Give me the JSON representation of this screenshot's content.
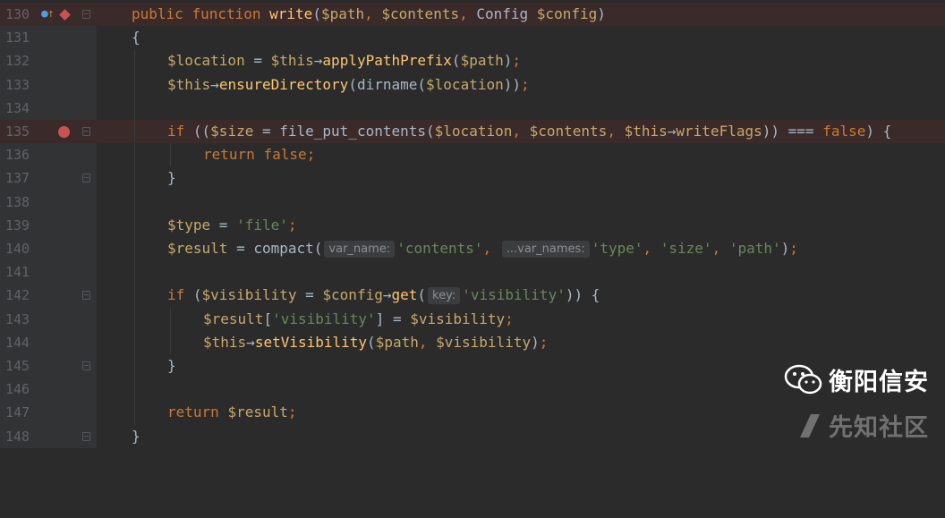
{
  "lines": [
    {
      "n": "130"
    },
    {
      "n": "131"
    },
    {
      "n": "132"
    },
    {
      "n": "133"
    },
    {
      "n": "134"
    },
    {
      "n": "135"
    },
    {
      "n": "136"
    },
    {
      "n": "137"
    },
    {
      "n": "138"
    },
    {
      "n": "139"
    },
    {
      "n": "140"
    },
    {
      "n": "141"
    },
    {
      "n": "142"
    },
    {
      "n": "143"
    },
    {
      "n": "144"
    },
    {
      "n": "145"
    },
    {
      "n": "146"
    },
    {
      "n": "147"
    },
    {
      "n": "148"
    }
  ],
  "code": {
    "l130": {
      "public": "public",
      "function": "function",
      "name": "write",
      "p1": "$path",
      "p2": "$contents",
      "type": "Config",
      "p3": "$config"
    },
    "l131": {
      "brace": "{"
    },
    "l132": {
      "var": "$location",
      "this": "$this",
      "arrow": "→",
      "method": "applyPathPrefix",
      "arg": "$path"
    },
    "l133": {
      "this": "$this",
      "arrow": "→",
      "method": "ensureDirectory",
      "fn": "dirname",
      "arg": "$location"
    },
    "l135": {
      "if": "if",
      "size": "$size",
      "fn": "file_put_contents",
      "a1": "$location",
      "a2": "$contents",
      "this": "$this",
      "arrow": "→",
      "prop": "writeFlags",
      "eq": "===",
      "false": "false"
    },
    "l136": {
      "return": "return",
      "false": "false"
    },
    "l137": {
      "brace": "}"
    },
    "l139": {
      "var": "$type",
      "str": "'file'"
    },
    "l140": {
      "var": "$result",
      "fn": "compact",
      "hint1": "var_name:",
      "s1": "'contents'",
      "hint2": "...var_names:",
      "s2": "'type'",
      "s3": "'size'",
      "s4": "'path'"
    },
    "l142": {
      "if": "if",
      "var": "$visibility",
      "config": "$config",
      "arrow": "→",
      "method": "get",
      "hint": "key:",
      "str": "'visibility'"
    },
    "l143": {
      "var": "$result",
      "key": "'visibility'",
      "val": "$visibility"
    },
    "l144": {
      "this": "$this",
      "arrow": "→",
      "method": "setVisibility",
      "a1": "$path",
      "a2": "$visibility"
    },
    "l145": {
      "brace": "}"
    },
    "l147": {
      "return": "return",
      "var": "$result"
    },
    "l148": {
      "brace": "}"
    }
  },
  "watermark": {
    "top": "衡阳信安",
    "bottom": "先知社区"
  },
  "colors": {
    "keyword": "#cc7832",
    "function": "#ffc66d",
    "variable": "#c8a86a",
    "string": "#6a8759",
    "plain": "#a9b7c6",
    "breakpoint": "#c75450",
    "highlight": "#3b2a2a"
  }
}
